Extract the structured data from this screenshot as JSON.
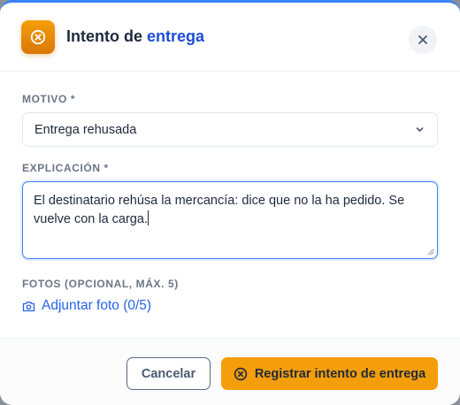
{
  "dialog": {
    "title_prefix": "Intento de",
    "title_accent": "entrega",
    "close_label": "×"
  },
  "form": {
    "motivo_label": "MOTIVO *",
    "motivo_value": "Entrega rehusada",
    "explicacion_label": "EXPLICACIÓN *",
    "explicacion_value": "El destinatario rehúsa la mercancía: dice que no la ha pedido. Se vuelve con la carga.",
    "fotos_label": "FOTOS (OPCIONAL, MÁX. 5)",
    "attach_label": "Adjuntar foto (0/5)"
  },
  "footer": {
    "cancel_label": "Cancelar",
    "submit_label": "Registrar intento de entrega"
  },
  "colors": {
    "accent": "#f59e0b",
    "link": "#2563eb",
    "focus": "#3b82f6"
  },
  "icons": {
    "header": "x-circle-icon",
    "select": "chevron-down-icon",
    "attach": "camera-icon",
    "submit": "x-circle-icon"
  }
}
